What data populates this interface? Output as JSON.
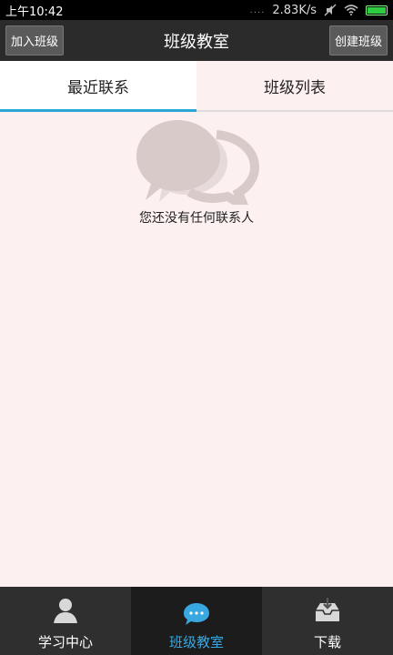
{
  "status_bar": {
    "time": "上午10:42",
    "network_speed": "2.83K/s",
    "signal_dots": "....",
    "battery_color": "#2ecc40"
  },
  "title_bar": {
    "title": "班级教室",
    "left_button": "加入班级",
    "right_button": "创建班级"
  },
  "tabs": [
    {
      "label": "最近联系",
      "active": true
    },
    {
      "label": "班级列表",
      "active": false
    }
  ],
  "empty_state": {
    "icon": "chat-bubbles-icon",
    "message": "您还没有任何联系人"
  },
  "bottom_nav": [
    {
      "label": "学习中心",
      "icon": "user-icon",
      "active": false
    },
    {
      "label": "班级教室",
      "icon": "chat-icon",
      "active": true
    },
    {
      "label": "下载",
      "icon": "download-box-icon",
      "active": false
    }
  ],
  "colors": {
    "accent": "#29a8d8",
    "background": "#fdf0f0",
    "title_bar": "#2b2b2b",
    "bottom_nav": "#2f2f2f"
  }
}
